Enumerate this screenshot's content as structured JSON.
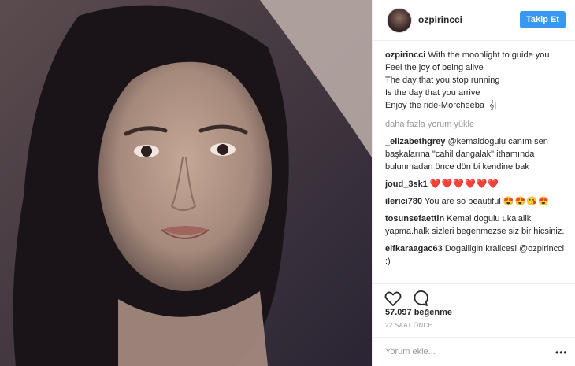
{
  "post": {
    "username": "ozpirincci",
    "follow_label": "Takip Et",
    "caption_lines": [
      "With the moonlight to guide you",
      "Feel the joy of being alive",
      "The day that you stop running",
      "Is the day that you arrive",
      "Enjoy the ride-Morcheeba"
    ],
    "caption_icon": "music-note-icon",
    "load_more": "daha fazla yorum yükle",
    "comments": [
      {
        "user": "_elizabethgrey",
        "text": "@kemaldogulu canım sen başkalarına \"cahil dangalak\" ithamında bulunmadan önce dön bi kendine bak"
      },
      {
        "user": "joud_3sk1",
        "text": "",
        "emoji": "❤️❤️❤️❤️❤️❤️"
      },
      {
        "user": "ilerici780",
        "text": "You are so beautiful",
        "emoji": "😍😍😘😍"
      },
      {
        "user": "tosunsefaettin",
        "text": "Kemal dogulu ukalalik yapma.halk sizleri begenmezse siz bir hicsiniz."
      },
      {
        "user": "elfkaraagac63",
        "text": "Dogalligin kralicesi @ozpirincci :)"
      }
    ],
    "likes": "57.097 beğenme",
    "time": "22 SAAT ÖNCE",
    "comment_placeholder": "Yorum ekle...",
    "icons": {
      "like": "heart-outline-icon",
      "comment": "speech-bubble-icon",
      "more": "ellipsis-icon"
    },
    "accent_color": "#3897f0"
  }
}
